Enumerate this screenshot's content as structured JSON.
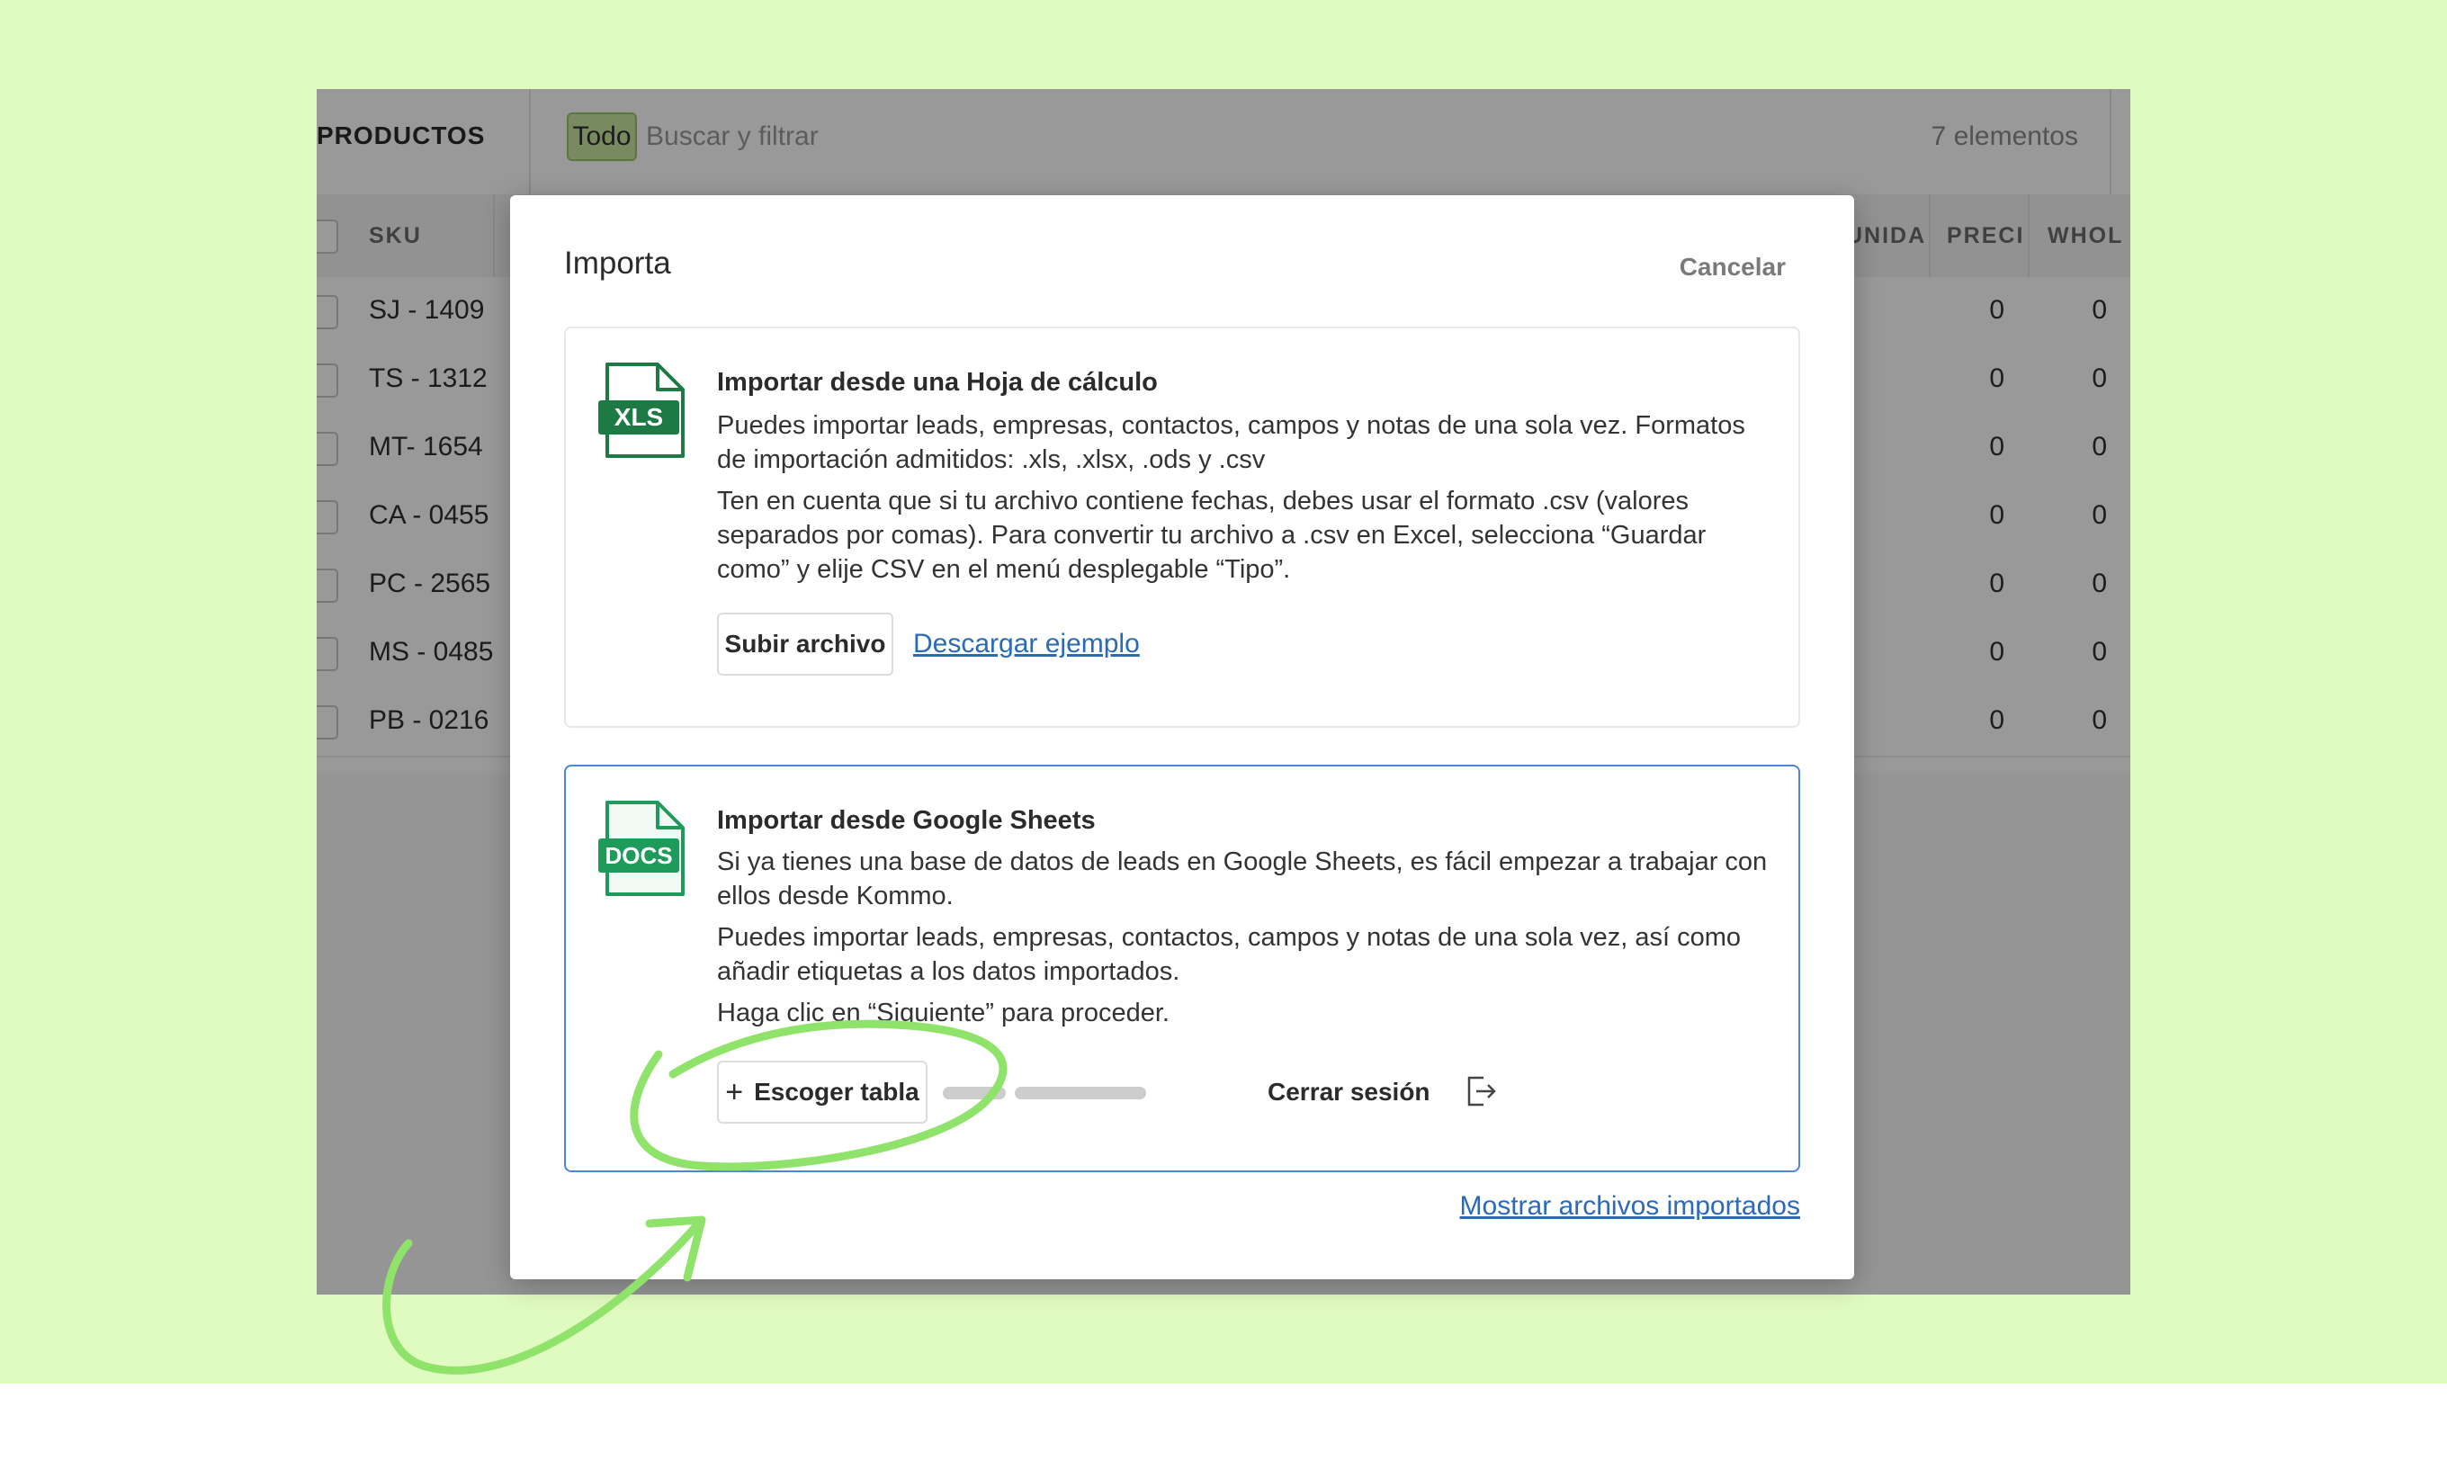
{
  "app": {
    "section_title": "PRODUCTOS",
    "filter_chip": "Todo",
    "search_placeholder": "Buscar y filtrar",
    "item_count": "7 elementos",
    "columns": [
      "SKU",
      "UNIDA",
      "PRECI",
      "WHOL"
    ],
    "rows": [
      {
        "sku": "SJ - 1409",
        "precio": "0",
        "wholesale": "0"
      },
      {
        "sku": "TS - 1312",
        "precio": "0",
        "wholesale": "0"
      },
      {
        "sku": "MT- 1654",
        "precio": "0",
        "wholesale": "0"
      },
      {
        "sku": "CA - 0455",
        "precio": "0",
        "wholesale": "0"
      },
      {
        "sku": "PC - 2565",
        "precio": "0",
        "wholesale": "0"
      },
      {
        "sku": "MS - 0485",
        "precio": "0",
        "wholesale": "0"
      },
      {
        "sku": "PB - 0216",
        "precio": "0",
        "wholesale": "0"
      }
    ]
  },
  "modal": {
    "title": "Importa",
    "cancel_label": "Cancelar",
    "spreadsheet": {
      "icon_label": "XLS",
      "title": "Importar desde una Hoja de cálculo",
      "text1": "Puedes importar leads, empresas, contactos, campos y notas de una sola vez. Formatos de importación admitidos: .xls, .xlsx, .ods y .csv",
      "text2": "Ten en cuenta que si tu archivo contiene fechas, debes usar el formato .csv (valores separados por comas). Para convertir tu archivo a .csv en Excel, selecciona “Guardar como” y elije CSV en el menú desplegable “Tipo”.",
      "upload_label": "Subir archivo",
      "example_link": "Descargar ejemplo"
    },
    "google_sheets": {
      "icon_label": "DOCS",
      "title": "Importar desde Google Sheets",
      "text1": "Si ya tienes una base de datos de leads en Google Sheets, es fácil empezar a trabajar con ellos desde Kommo.",
      "text2": "Puedes importar leads, empresas, contactos, campos y notas de una sola vez, así como añadir etiquetas a los datos importados.",
      "text3": "Haga clic en “Siguiente” para proceder.",
      "choose_label": "Escoger tabla",
      "logout_label": "Cerrar sesión"
    },
    "show_imported_link": "Mostrar archivos importados"
  },
  "colors": {
    "page_background": "#e0fbc0",
    "annotation_stroke": "#8fe36a",
    "xls_icon": "#1d7a45",
    "docs_icon": "#1e9a5a",
    "link": "#2a6ab8",
    "active_card_border": "#4d86d6"
  },
  "icons": [
    "xls-file-icon",
    "docs-file-icon",
    "plus-icon",
    "logout-icon"
  ]
}
